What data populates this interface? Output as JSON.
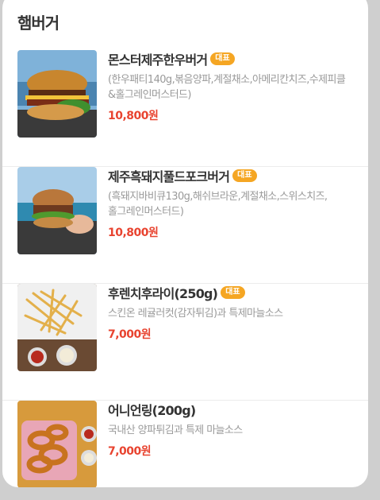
{
  "section": {
    "title": "햄버거"
  },
  "menu_items": [
    {
      "name": "몬스터제주한우버거",
      "badge": "대표",
      "desc_line1": "(한우패티140g,볶음양파,계절채소,아메리칸치즈,수제피클",
      "desc_line2": "&홀그레인머스터드)",
      "price": "10,800원"
    },
    {
      "name": "제주흑돼지풀드포크버거",
      "badge": "대표",
      "desc_line1": "(흑돼지바비큐130g,해쉬브라운,계절채소,스위스치즈,",
      "desc_line2": "홀그레인머스터드)",
      "price": "10,800원"
    },
    {
      "name": "후렌치후라이(250g)",
      "badge": "대표",
      "desc_line1": "스킨온 레귤러컷(감자튀김)과 특제마늘소스",
      "desc_line2": "",
      "price": "7,000원"
    },
    {
      "name": "어니언링(200g)",
      "badge": "",
      "desc_line1": "국내산 양파튀김과 특제 마늘소스",
      "desc_line2": "",
      "price": "7,000원"
    }
  ],
  "colors": {
    "accent_price": "#e8432f",
    "badge_bg": "#f5a623",
    "page_bg": "#cfcfcf"
  }
}
